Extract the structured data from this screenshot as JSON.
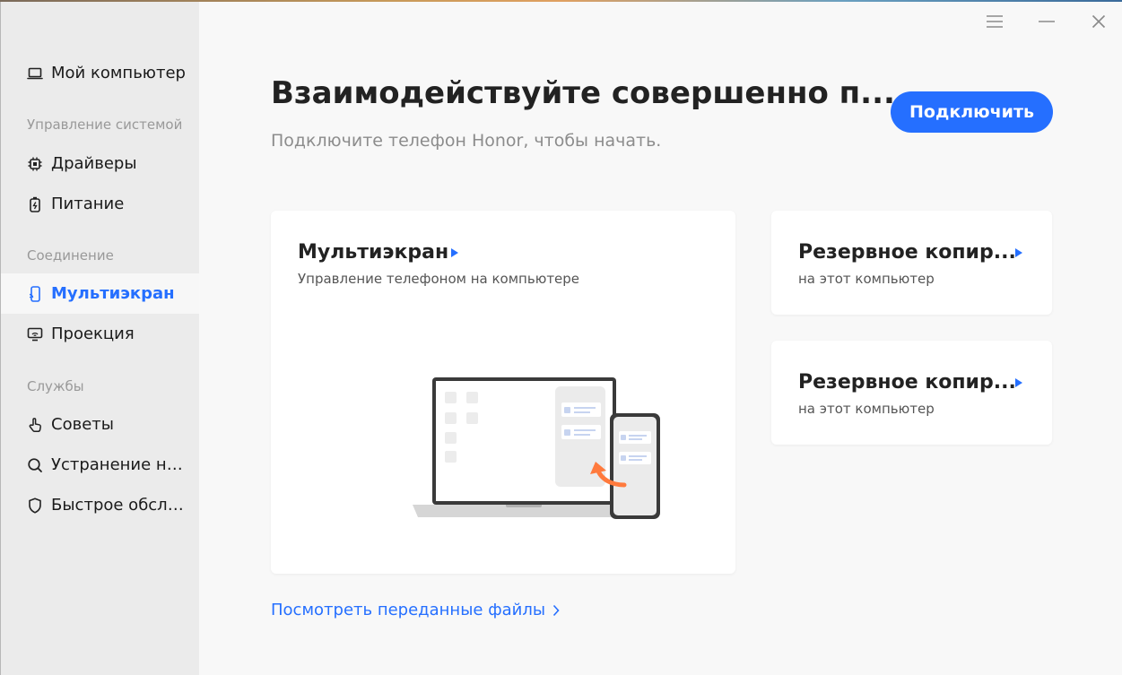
{
  "sidebar": {
    "my_computer": "Мой компьютер",
    "section_system": "Управление системой",
    "drivers": "Драйверы",
    "power": "Питание",
    "section_connection": "Соединение",
    "multiscreen": "Мультиэкран",
    "projection": "Проекция",
    "section_services": "Службы",
    "tips": "Советы",
    "troubleshoot": "Устранение не...",
    "quick_service": "Быстрое обслу..."
  },
  "header": {
    "title": "Взаимодействуйте совершенно п...",
    "subtitle": "Подключите телефон Honor, чтобы начать.",
    "connect_label": "Подключить"
  },
  "cards": {
    "multiscreen": {
      "title": "Мультиэкран",
      "subtitle": "Управление телефоном на компьютере"
    },
    "backup1": {
      "title": "Резервное копир...",
      "subtitle": "на этот компьютер"
    },
    "backup2": {
      "title": "Резервное копир...",
      "subtitle": "на этот компьютер"
    }
  },
  "files_link": "Посмотреть переданные файлы",
  "colors": {
    "accent": "#256fff",
    "sidebar_bg": "#ebebeb",
    "main_bg": "#f8f8f8",
    "illustration_arrow": "#ff7a3d"
  },
  "icons": {
    "my_computer": "laptop-icon",
    "drivers": "chip-icon",
    "power": "battery-icon",
    "multiscreen": "phone-cast-icon",
    "projection": "screen-cast-icon",
    "tips": "hand-icon",
    "troubleshoot": "search-icon",
    "quick_service": "shield-icon",
    "menu": "menu-icon",
    "minimize": "minimize-icon",
    "close": "close-icon"
  }
}
